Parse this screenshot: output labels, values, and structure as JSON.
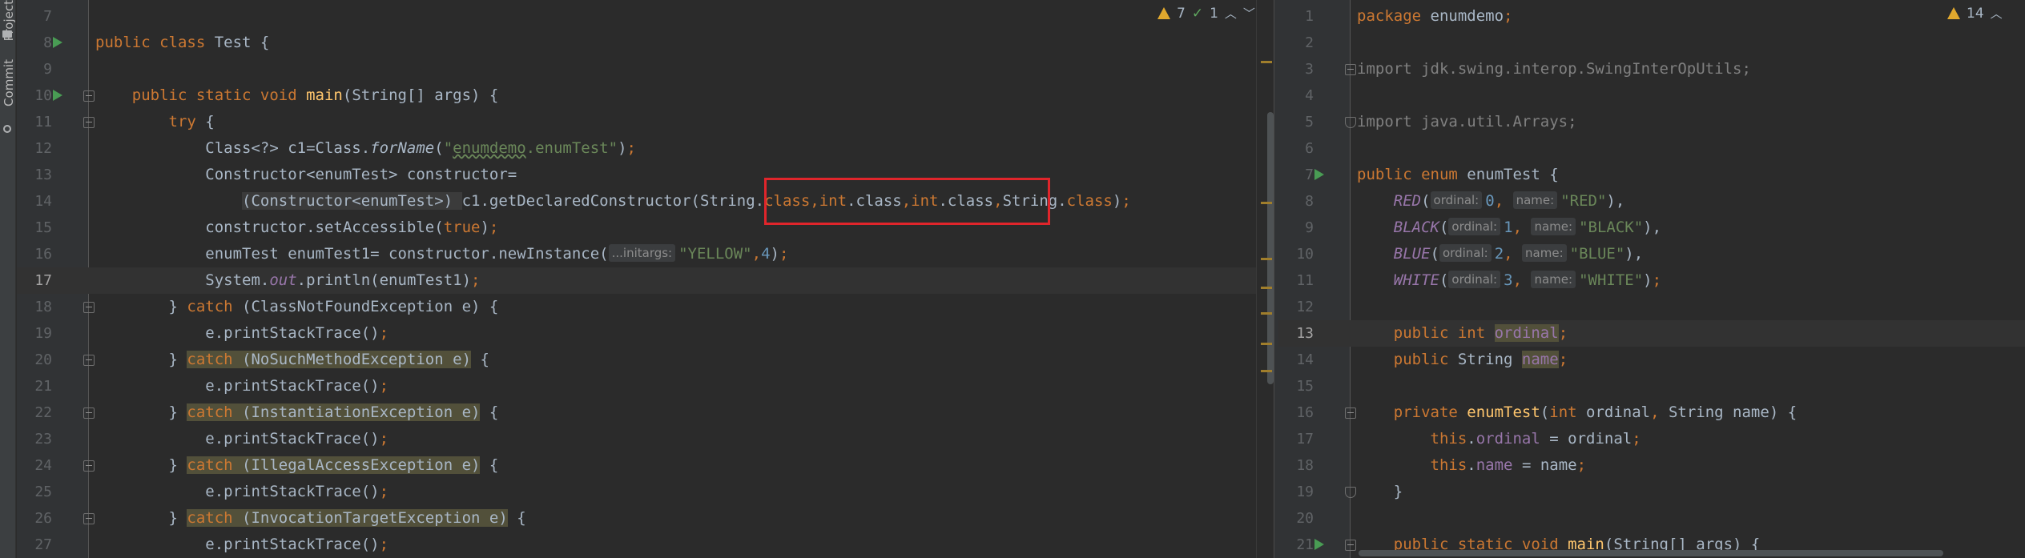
{
  "sidebar": {
    "tabs": [
      {
        "label": "Project",
        "icon": "folder-icon"
      },
      {
        "label": "Commit",
        "icon": "commit-icon"
      }
    ]
  },
  "left_editor": {
    "inspection": {
      "warnings": "7",
      "weak_warnings": "1"
    },
    "current_line": 17,
    "lines": [
      {
        "n": "7",
        "tokens": []
      },
      {
        "n": "8",
        "run": true,
        "tokens": [
          [
            "kw",
            "public class "
          ],
          [
            "",
            "Test {"
          ]
        ]
      },
      {
        "n": "9",
        "tokens": []
      },
      {
        "n": "10",
        "run": true,
        "fold": "open",
        "tokens": [
          [
            "",
            "    "
          ],
          [
            "kw",
            "public static void "
          ],
          [
            "fn",
            "main"
          ],
          [
            "",
            "(String[] args) {"
          ]
        ]
      },
      {
        "n": "11",
        "fold": "open",
        "tokens": [
          [
            "",
            "        "
          ],
          [
            "kw",
            "try "
          ],
          [
            "",
            "{"
          ]
        ]
      },
      {
        "n": "12",
        "tokens": [
          [
            "",
            "            Class<?> c1=Class."
          ],
          [
            "stat",
            "forName"
          ],
          [
            "",
            "("
          ],
          [
            "str",
            "\""
          ],
          [
            "str pkgu",
            "enumdemo"
          ],
          [
            "str",
            ".enumTest\""
          ],
          [
            "",
            ")"
          ],
          [
            "kw",
            ";"
          ]
        ]
      },
      {
        "n": "13",
        "tokens": [
          [
            "",
            "            Constructor<enumTest> constructor="
          ]
        ]
      },
      {
        "n": "14",
        "tokens": [
          [
            "",
            "                "
          ],
          [
            "warnhl",
            "(Constructor<enumTest>) "
          ],
          [
            "",
            "c1.getDeclaredConstructor("
          ],
          [
            "",
            "String."
          ],
          [
            "kw",
            "class"
          ],
          [
            "kw",
            ","
          ],
          [
            "kw",
            "int"
          ],
          [
            "",
            ".class"
          ],
          [
            "kw",
            ","
          ],
          [
            "kw",
            "int"
          ],
          [
            "",
            ".class"
          ],
          [
            "kw",
            ","
          ],
          [
            "",
            "String."
          ],
          [
            "kw",
            "class"
          ],
          [
            "",
            ")"
          ],
          [
            "kw",
            ";"
          ]
        ]
      },
      {
        "n": "15",
        "tokens": [
          [
            "",
            "            constructor.setAccessible("
          ],
          [
            "kw",
            "true"
          ],
          [
            "",
            ")"
          ],
          [
            "kw",
            ";"
          ]
        ]
      },
      {
        "n": "16",
        "tokens": [
          [
            "",
            "            enumTest enumTest1= constructor.newInstance("
          ],
          [
            "hint",
            "...initargs:"
          ],
          [
            "str",
            "\"YELLOW\""
          ],
          [
            "kw",
            ","
          ],
          [
            "num",
            "4"
          ],
          [
            "",
            ")"
          ],
          [
            "kw",
            ";"
          ]
        ]
      },
      {
        "n": "17",
        "tokens": [
          [
            "",
            "            System."
          ],
          [
            "field stat",
            "out"
          ],
          [
            "",
            ".println(enumTest1)"
          ],
          [
            "kw",
            ";"
          ]
        ]
      },
      {
        "n": "18",
        "fold": "open",
        "tokens": [
          [
            "",
            "        } "
          ],
          [
            "kw",
            "catch "
          ],
          [
            "",
            "(ClassNotFoundException e) {"
          ]
        ]
      },
      {
        "n": "19",
        "tokens": [
          [
            "",
            "            e.printStackTrace()"
          ],
          [
            "kw",
            ";"
          ]
        ]
      },
      {
        "n": "20",
        "fold": "open",
        "tokens": [
          [
            "",
            "        } "
          ],
          [
            "kw hl",
            "catch "
          ],
          [
            "hl",
            "(NoSuchMethodException e)"
          ],
          [
            "",
            " {"
          ]
        ]
      },
      {
        "n": "21",
        "tokens": [
          [
            "",
            "            e.printStackTrace()"
          ],
          [
            "kw",
            ";"
          ]
        ]
      },
      {
        "n": "22",
        "fold": "open",
        "tokens": [
          [
            "",
            "        } "
          ],
          [
            "kw hl",
            "catch "
          ],
          [
            "hl",
            "(InstantiationException e)"
          ],
          [
            "",
            " {"
          ]
        ]
      },
      {
        "n": "23",
        "tokens": [
          [
            "",
            "            e.printStackTrace()"
          ],
          [
            "kw",
            ";"
          ]
        ]
      },
      {
        "n": "24",
        "fold": "open",
        "tokens": [
          [
            "",
            "        } "
          ],
          [
            "kw hl",
            "catch "
          ],
          [
            "hl",
            "(IllegalAccessException e)"
          ],
          [
            "",
            " {"
          ]
        ]
      },
      {
        "n": "25",
        "tokens": [
          [
            "",
            "            e.printStackTrace()"
          ],
          [
            "kw",
            ";"
          ]
        ]
      },
      {
        "n": "26",
        "fold": "open",
        "tokens": [
          [
            "",
            "        } "
          ],
          [
            "kw hl",
            "catch "
          ],
          [
            "hl",
            "(InvocationTargetException e)"
          ],
          [
            "",
            " {"
          ]
        ]
      },
      {
        "n": "27",
        "tokens": [
          [
            "",
            "            e.printStackTrace()"
          ],
          [
            "kw",
            ";"
          ]
        ]
      }
    ]
  },
  "right_editor": {
    "inspection": {
      "warnings": "14"
    },
    "current_line": 13,
    "lines": [
      {
        "n": "1",
        "tokens": [
          [
            "kw",
            "package "
          ],
          [
            "",
            "enumdemo"
          ],
          [
            "kw",
            ";"
          ]
        ]
      },
      {
        "n": "2",
        "tokens": []
      },
      {
        "n": "3",
        "fold": "open",
        "tokens": [
          [
            "kw unused",
            "import "
          ],
          [
            "unused",
            "jdk.swing.interop.SwingInterOpUtils;"
          ]
        ]
      },
      {
        "n": "4",
        "tokens": []
      },
      {
        "n": "5",
        "fold": "end",
        "tokens": [
          [
            "kw unused",
            "import "
          ],
          [
            "unused",
            "java.util.Arrays;"
          ]
        ]
      },
      {
        "n": "6",
        "tokens": []
      },
      {
        "n": "7",
        "run": true,
        "tokens": [
          [
            "kw",
            "public enum "
          ],
          [
            "",
            "enumTest {"
          ]
        ]
      },
      {
        "n": "8",
        "tokens": [
          [
            "",
            "    "
          ],
          [
            "const",
            "RED"
          ],
          [
            "",
            "("
          ],
          [
            "hint",
            "ordinal:"
          ],
          [
            "num",
            "0"
          ],
          [
            "kw",
            ", "
          ],
          [
            "hint",
            "name:"
          ],
          [
            "str",
            "\"RED\""
          ],
          [
            "",
            "),"
          ]
        ]
      },
      {
        "n": "9",
        "tokens": [
          [
            "",
            "    "
          ],
          [
            "const",
            "BLACK"
          ],
          [
            "",
            "("
          ],
          [
            "hint",
            "ordinal:"
          ],
          [
            "num",
            "1"
          ],
          [
            "kw",
            ", "
          ],
          [
            "hint",
            "name:"
          ],
          [
            "str",
            "\"BLACK\""
          ],
          [
            "",
            "),"
          ]
        ]
      },
      {
        "n": "10",
        "tokens": [
          [
            "",
            "    "
          ],
          [
            "const",
            "BLUE"
          ],
          [
            "",
            "("
          ],
          [
            "hint",
            "ordinal:"
          ],
          [
            "num",
            "2"
          ],
          [
            "kw",
            ", "
          ],
          [
            "hint",
            "name:"
          ],
          [
            "str",
            "\"BLUE\""
          ],
          [
            "",
            "),"
          ]
        ]
      },
      {
        "n": "11",
        "tokens": [
          [
            "",
            "    "
          ],
          [
            "const",
            "WHITE"
          ],
          [
            "",
            "("
          ],
          [
            "hint",
            "ordinal:"
          ],
          [
            "num",
            "3"
          ],
          [
            "kw",
            ", "
          ],
          [
            "hint",
            "name:"
          ],
          [
            "str",
            "\"WHITE\""
          ],
          [
            "",
            ")"
          ],
          [
            "kw",
            ";"
          ]
        ]
      },
      {
        "n": "12",
        "tokens": []
      },
      {
        "n": "13",
        "tokens": [
          [
            "",
            "    "
          ],
          [
            "kw",
            "public int "
          ],
          [
            "field hl",
            "ordinal"
          ],
          [
            "kw",
            ";"
          ]
        ]
      },
      {
        "n": "14",
        "tokens": [
          [
            "",
            "    "
          ],
          [
            "kw",
            "public "
          ],
          [
            "",
            "String "
          ],
          [
            "field hl",
            "name"
          ],
          [
            "kw",
            ";"
          ]
        ]
      },
      {
        "n": "15",
        "tokens": []
      },
      {
        "n": "16",
        "fold": "open",
        "tokens": [
          [
            "",
            "    "
          ],
          [
            "kw",
            "private "
          ],
          [
            "fn",
            "enumTest"
          ],
          [
            "",
            "("
          ],
          [
            "kw",
            "int "
          ],
          [
            "",
            "ordinal"
          ],
          [
            "kw",
            ", "
          ],
          [
            "",
            "String name) {"
          ]
        ]
      },
      {
        "n": "17",
        "tokens": [
          [
            "",
            "        "
          ],
          [
            "kw",
            "this"
          ],
          [
            "",
            "."
          ],
          [
            "field",
            "ordinal"
          ],
          [
            "",
            " = ordinal"
          ],
          [
            "kw",
            ";"
          ]
        ]
      },
      {
        "n": "18",
        "tokens": [
          [
            "",
            "        "
          ],
          [
            "kw",
            "this"
          ],
          [
            "",
            "."
          ],
          [
            "field",
            "name"
          ],
          [
            "",
            " = name"
          ],
          [
            "kw",
            ";"
          ]
        ]
      },
      {
        "n": "19",
        "fold": "end",
        "tokens": [
          [
            "",
            "    }"
          ]
        ]
      },
      {
        "n": "20",
        "tokens": []
      },
      {
        "n": "21",
        "run": true,
        "fold": "open",
        "tokens": [
          [
            "",
            "    "
          ],
          [
            "kw",
            "public static void "
          ],
          [
            "fn",
            "main"
          ],
          [
            "",
            "(String[] args) {"
          ]
        ]
      }
    ]
  },
  "colors": {
    "warning": "#e0a82e",
    "highlight_box": "#e0252b",
    "run": "#499c54"
  }
}
